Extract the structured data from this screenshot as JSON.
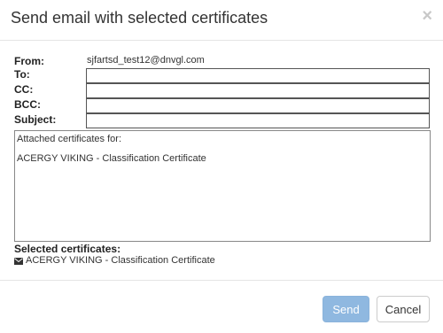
{
  "dialog": {
    "title": "Send email with selected certificates",
    "close_glyph": "×"
  },
  "form": {
    "from_label": "From:",
    "from_value": "sjfartsd_test12@dnvgl.com",
    "to_label": "To:",
    "to_value": "",
    "cc_label": "CC:",
    "cc_value": "",
    "bcc_label": "BCC:",
    "bcc_value": "",
    "subject_label": "Subject:",
    "subject_value": "",
    "message_line1": "Attached certificates for:",
    "message_line2": "ACERGY VIKING - Classification Certificate"
  },
  "selected": {
    "label": "Selected certificates:",
    "items": [
      {
        "icon": "envelope-icon",
        "text": "ACERGY VIKING - Classification Certificate"
      }
    ]
  },
  "footer": {
    "send_label": "Send",
    "cancel_label": "Cancel"
  },
  "colors": {
    "send_button": "#8fb8e0",
    "border": "#e5e5e5"
  }
}
